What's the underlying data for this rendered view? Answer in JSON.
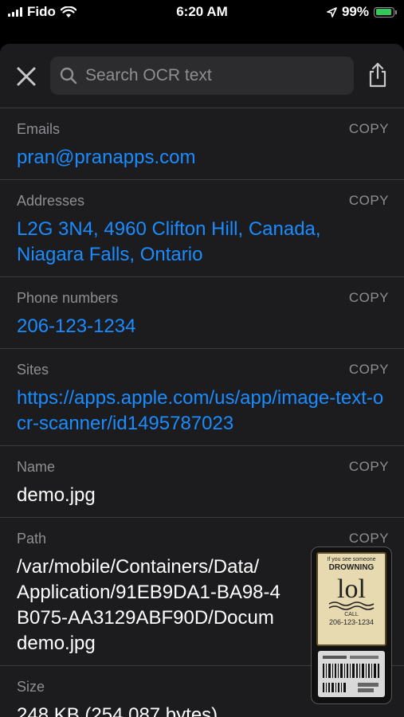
{
  "status": {
    "carrier": "Fido",
    "time": "6:20 AM",
    "battery": "99%",
    "battery_level": 0.99
  },
  "search": {
    "placeholder": "Search OCR text"
  },
  "icons": {
    "close": "close-icon",
    "search": "search-icon",
    "share": "share-icon",
    "wifi": "wifi-icon",
    "location": "location-arrow-icon"
  },
  "copy_label": "COPY",
  "rows": [
    {
      "label": "Emails",
      "value": "pran@pranapps.com",
      "is_link": true
    },
    {
      "label": "Addresses",
      "value": "L2G 3N4, 4960 Clifton Hill, Canada, Niagara Falls, Ontario",
      "is_link": true
    },
    {
      "label": "Phone numbers",
      "value": "206-123-1234",
      "is_link": true
    },
    {
      "label": "Sites",
      "value": "https://apps.apple.com/us/app/image-text-ocr-scanner/id1495787023",
      "is_link": true
    },
    {
      "label": "Name",
      "value": "demo.jpg",
      "is_link": false
    },
    {
      "label": "Path",
      "value": "/var/mobile/Containers/Data/\nApplication/91EB9DA1-BA98-4\nB075-AA3129ABF90D/Docum\ndemo.jpg",
      "is_link": false
    },
    {
      "label": "Size",
      "value": "248 KB (254,087 bytes)",
      "is_link": false
    }
  ],
  "thumbnail": {
    "line1": "If you see someone",
    "line2": "DROWNING",
    "line3": "lol",
    "line4": "CALL",
    "line5": "206-123-1234"
  },
  "colors": {
    "link": "#1a8cff",
    "background": "#1c1c1e",
    "secondary_text": "#8e8e93",
    "battery": "#34c759"
  }
}
